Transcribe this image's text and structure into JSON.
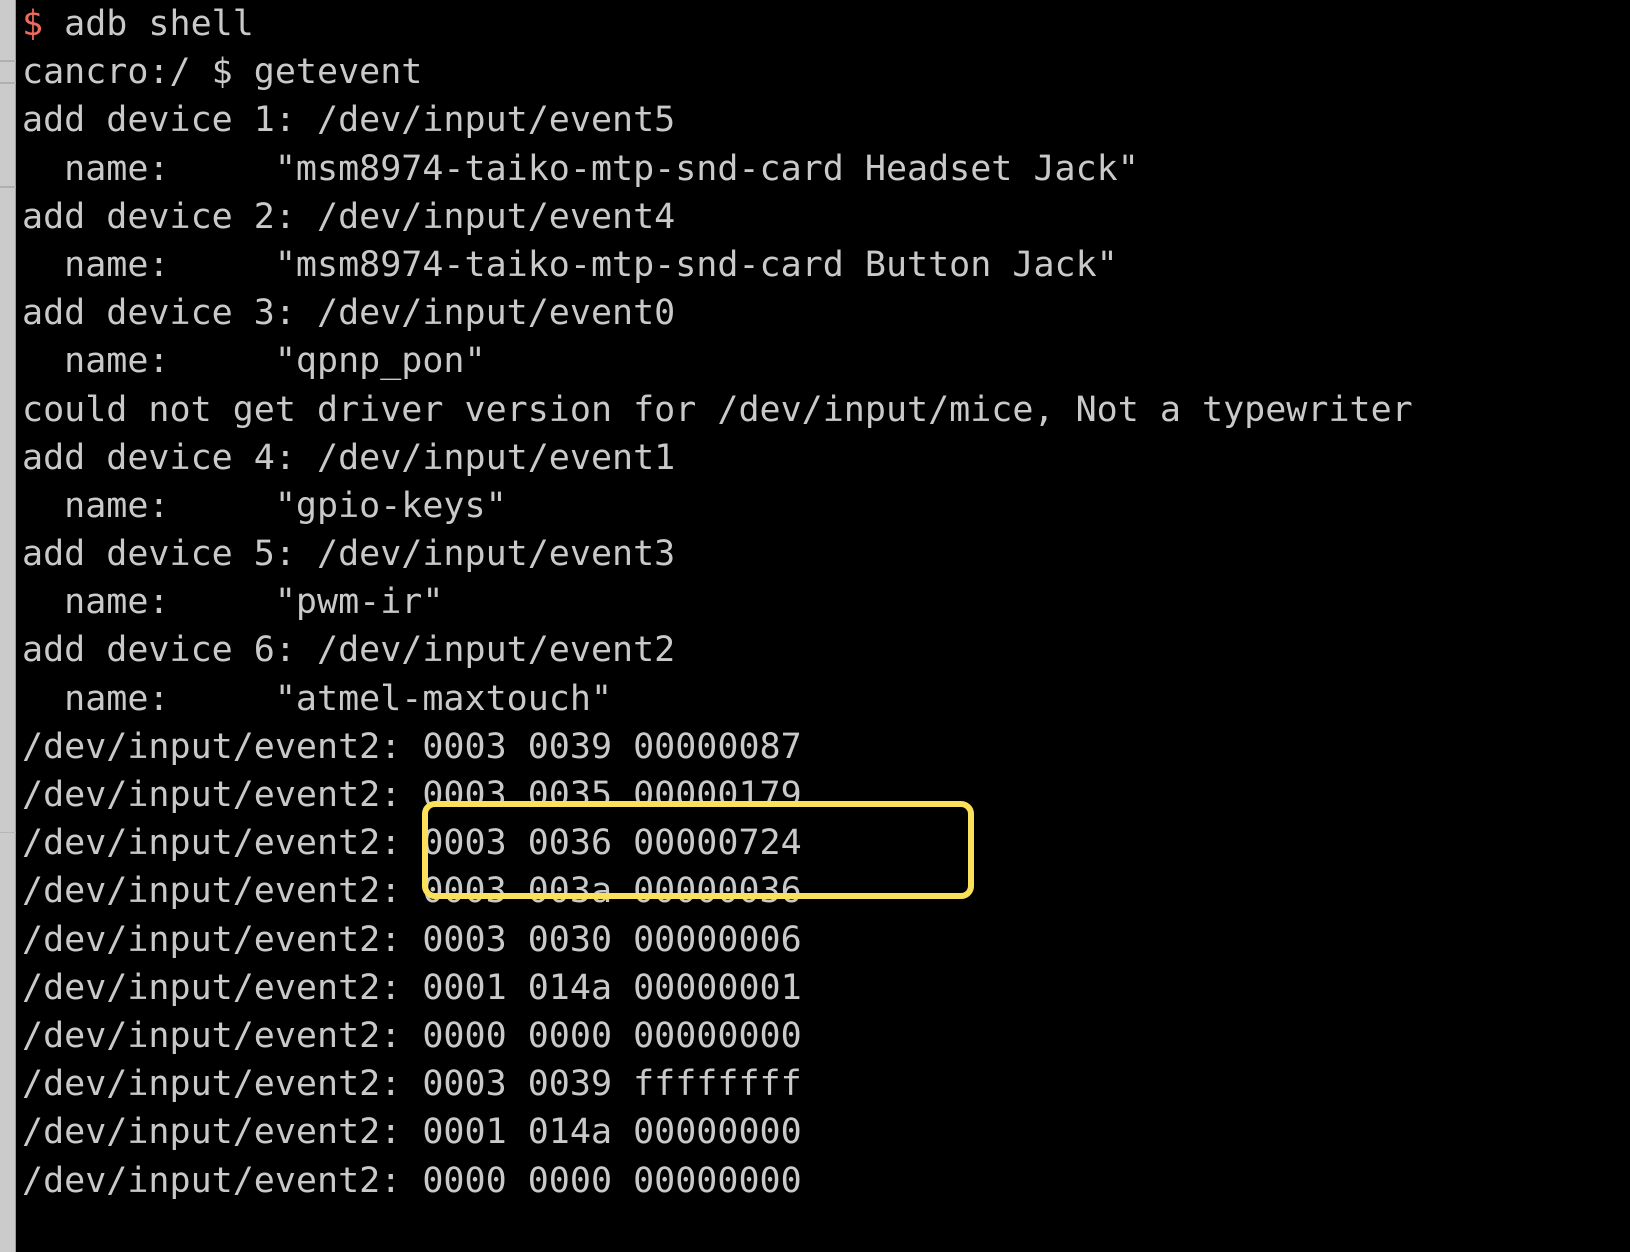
{
  "terminal": {
    "prompt_sigil": "$",
    "prompt_sigil_color": "#ef6a5e",
    "foreground_color": "#c9c9c9",
    "background_color": "#000000",
    "first_command": " adb shell",
    "lines": [
      "cancro:/ $ getevent",
      "add device 1: /dev/input/event5",
      "  name:     \"msm8974-taiko-mtp-snd-card Headset Jack\"",
      "add device 2: /dev/input/event4",
      "  name:     \"msm8974-taiko-mtp-snd-card Button Jack\"",
      "add device 3: /dev/input/event0",
      "  name:     \"qpnp_pon\"",
      "could not get driver version for /dev/input/mice, Not a typewriter",
      "add device 4: /dev/input/event1",
      "  name:     \"gpio-keys\"",
      "add device 5: /dev/input/event3",
      "  name:     \"pwm-ir\"",
      "add device 6: /dev/input/event2",
      "  name:     \"atmel-maxtouch\"",
      "/dev/input/event2: 0003 0039 00000087",
      "/dev/input/event2: 0003 0035 00000179",
      "/dev/input/event2: 0003 0036 00000724",
      "/dev/input/event2: 0003 003a 00000036",
      "/dev/input/event2: 0003 0030 00000006",
      "/dev/input/event2: 0001 014a 00000001",
      "/dev/input/event2: 0000 0000 00000000",
      "/dev/input/event2: 0003 0039 ffffffff",
      "/dev/input/event2: 0001 014a 00000000",
      "/dev/input/event2: 0000 0000 00000000"
    ]
  },
  "annotation": {
    "highlight_color": "#fbe159",
    "highlighted_lines": [
      "0003 0035 00000179",
      "0003 0036 00000724"
    ]
  },
  "gutter": {
    "color": "#cbcbcb"
  }
}
